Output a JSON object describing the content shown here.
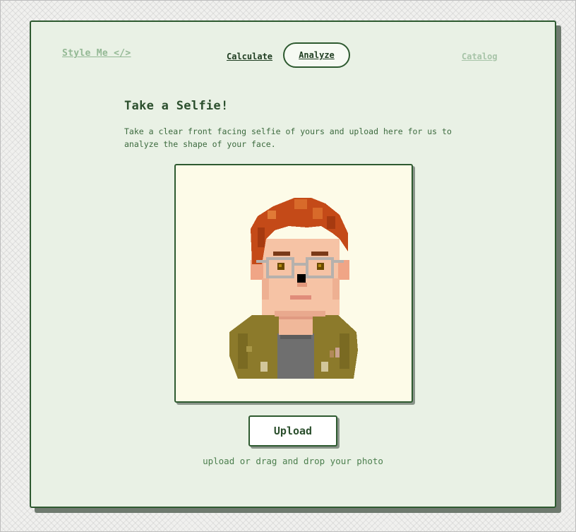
{
  "nav": {
    "brand": "Style Me </>",
    "links": [
      {
        "label": "Calculate"
      },
      {
        "label": "Analyze",
        "active": true
      },
      {
        "label": "Catalog"
      }
    ]
  },
  "main": {
    "title": "Take a Selfie!",
    "description": "Take a clear front facing selfie of yours and upload here for us to analyze the shape of your face.",
    "upload_button": "Upload",
    "upload_hint": "upload or drag and drop your photo"
  },
  "colors": {
    "accent": "#2e5a30",
    "card_background": "#e9f1e5",
    "photo_background": "#fdfbe8"
  },
  "icons": {
    "portrait": "pixel-art-portrait-icon"
  }
}
